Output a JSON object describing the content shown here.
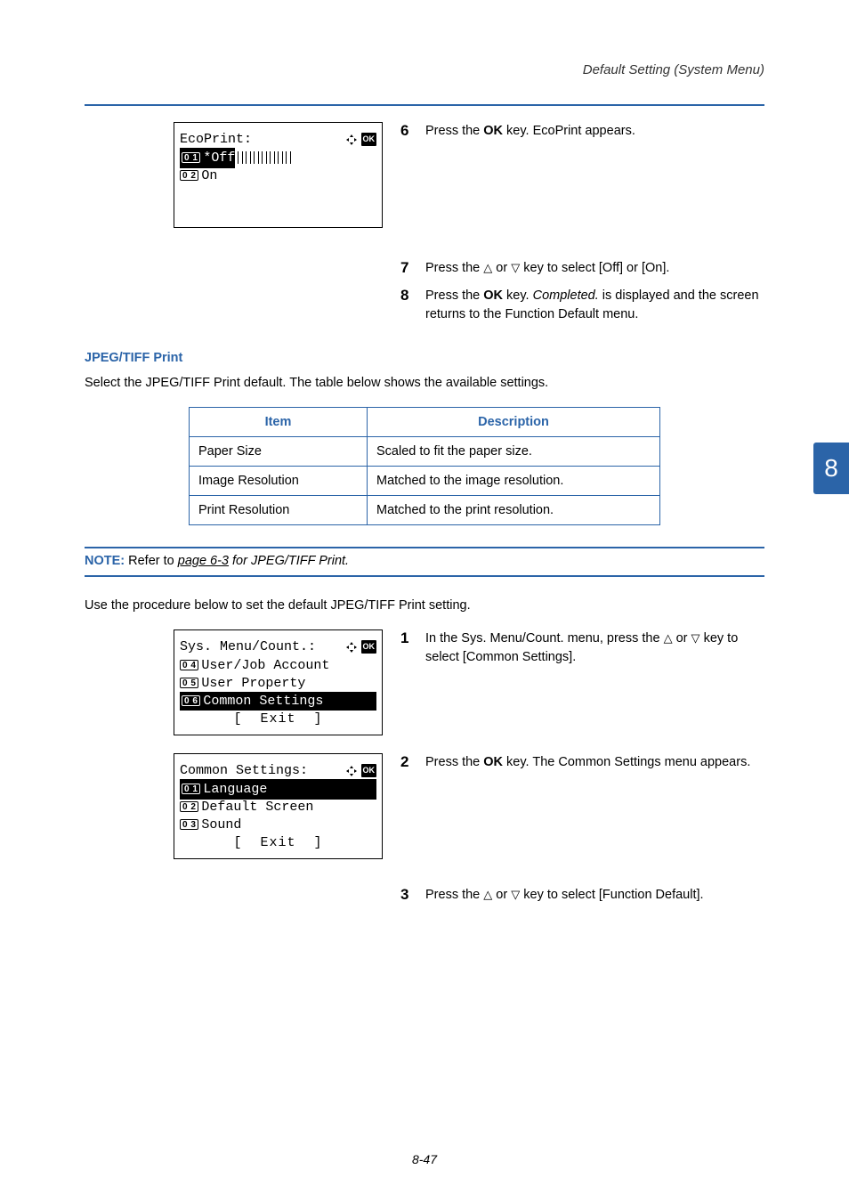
{
  "header": {
    "title": "Default Setting (System Menu)"
  },
  "sideTab": {
    "label": "8"
  },
  "footer": {
    "page": "8-47"
  },
  "lcd1": {
    "title": "EcoPrint:",
    "opt1_num": "0 1",
    "opt1_text": "*Off",
    "opt2_num": "0 2",
    "opt2_text": "On"
  },
  "steps_top": {
    "s6_num": "6",
    "s6_txt_a": "Press the ",
    "s6_txt_b": "OK",
    "s6_txt_c": " key. EcoPrint appears.",
    "s7_num": "7",
    "s7_txt_a": "Press the ",
    "s7_txt_b": " or ",
    "s7_txt_c": " key to select [Off] or [On].",
    "s8_num": "8",
    "s8_txt_a": "Press the ",
    "s8_txt_b": "OK",
    "s8_txt_c": " key. ",
    "s8_txt_d": "Completed.",
    "s8_txt_e": " is displayed and the screen returns to the Function Default menu."
  },
  "jpeg": {
    "heading": "JPEG/TIFF Print",
    "intro": "Select the JPEG/TIFF Print default. The table below shows the available settings."
  },
  "table": {
    "h1": "Item",
    "h2": "Description",
    "r1c1": "Paper Size",
    "r1c2": "Scaled to fit the paper size.",
    "r2c1": "Image Resolution",
    "r2c2": "Matched to the image resolution.",
    "r3c1": "Print Resolution",
    "r3c2": "Matched to the print resolution."
  },
  "note": {
    "label": "NOTE:",
    "text_a": " Refer to ",
    "link": "page 6-3",
    "text_b": " for JPEG/TIFF Print."
  },
  "proc": {
    "text": "Use the procedure below to set the default JPEG/TIFF Print setting."
  },
  "lcd2": {
    "title": "Sys. Menu/Count.:",
    "l1_num": "0 4",
    "l1_text": "User/Job Account",
    "l2_num": "0 5",
    "l2_text": "User Property",
    "l3_num": "0 6",
    "l3_text": "Common Settings",
    "exit": "[  Exit  ]"
  },
  "lcd3": {
    "title": "Common Settings:",
    "l1_num": "0 1",
    "l1_text": "Language",
    "l2_num": "0 2",
    "l2_text": "Default Screen",
    "l3_num": "0 3",
    "l3_text": "Sound",
    "exit": "[  Exit  ]"
  },
  "steps_bottom": {
    "s1_num": "1",
    "s1_txt_a": "In the Sys. Menu/Count. menu, press the ",
    "s1_txt_b": " or ",
    "s1_txt_c": " key to select [Common Settings].",
    "s2_num": "2",
    "s2_txt_a": "Press the ",
    "s2_txt_b": "OK",
    "s2_txt_c": " key. The Common Settings menu appears.",
    "s3_num": "3",
    "s3_txt_a": "Press the ",
    "s3_txt_b": " or ",
    "s3_txt_c": " key to select [Function Default]."
  },
  "icons": {
    "up": "△",
    "down": "▽"
  }
}
